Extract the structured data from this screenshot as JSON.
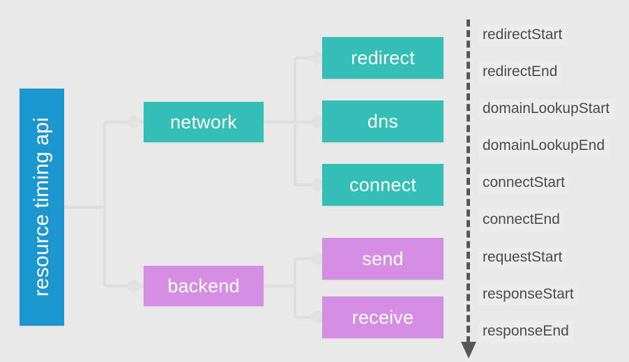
{
  "diagram": {
    "title": "resource timing api",
    "background_color": "#e9e9e9",
    "root": {
      "label": "resource timing api",
      "color": "#1c96ce"
    },
    "branches": [
      {
        "label": "network",
        "color": "#33bfb5",
        "children": [
          {
            "label": "redirect",
            "color": "#33bfb5"
          },
          {
            "label": "dns",
            "color": "#33bfb5"
          },
          {
            "label": "connect",
            "color": "#33bfb5"
          }
        ]
      },
      {
        "label": "backend",
        "color": "#d58ee4",
        "children": [
          {
            "label": "send",
            "color": "#d58ee4"
          },
          {
            "label": "receive",
            "color": "#d58ee4"
          }
        ]
      }
    ],
    "timeline": {
      "axis_style": "dashed",
      "axis_color": "#575757",
      "arrow_direction": "down",
      "marks": [
        {
          "label": "redirectStart"
        },
        {
          "label": "redirectEnd"
        },
        {
          "label": "domainLookupStart"
        },
        {
          "label": "domainLookupEnd"
        },
        {
          "label": "connectStart"
        },
        {
          "label": "connectEnd"
        },
        {
          "label": "requestStart"
        },
        {
          "label": "responseStart"
        },
        {
          "label": "responseEnd"
        }
      ]
    }
  }
}
